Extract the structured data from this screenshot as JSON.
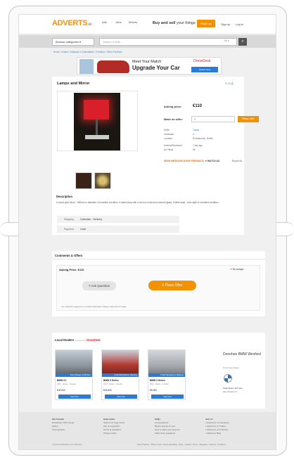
{
  "topbar": {
    "logo": "ADVERTS",
    "logo_suffix": ".ie",
    "tabs": [
      "Ads",
      "Jobs",
      "Motors"
    ],
    "tagline_prefix": "Buy and sell",
    "tagline_suffix": "your things",
    "place_ad": "Place ad",
    "signup": "Sign up",
    "login": "Log in"
  },
  "search": {
    "browse": "Browse categories",
    "placeholder": "Search in Ads ...",
    "scope": "All",
    "icon": "search-icon"
  },
  "breadcrumb": "Home › Ireland › Antiques & Collectables › Furniture › Other Furniture",
  "banner": {
    "line1": "Meet Your Match",
    "line2": "Upgrade Your Car",
    "brand": "DoneDeal",
    "cta": "Search Now"
  },
  "listing": {
    "title": "Lamps and Mirror",
    "asking_label": "Asking price:",
    "asking_value": "€110",
    "offer_label": "Make an offer:",
    "offer_placeholder": "€",
    "offer_button": "Place offer",
    "seller_rows": [
      {
        "k": "Seller",
        "v": "Troubt"
      },
      {
        "k": "Feedback",
        "v": "0"
      },
      {
        "k": "Location",
        "v": "Portmarnock, Dublin"
      },
      {
        "k": "Entered/Renewed",
        "v": "7 day ago"
      },
      {
        "k": "Ad Views",
        "v": "95"
      }
    ],
    "actions": [
      "SEND MESSAGE",
      "LEAVE FEEDBACK",
      "WATCH AD"
    ],
    "report": "Report Ad"
  },
  "description": {
    "heading": "Description",
    "text": "A round gold mirror - 800mm in diameter in excellent condition. A stand lamp with a red box head and coloured glass. A table lamp - retro style in excellent condition."
  },
  "options": [
    {
      "label": "Shipping",
      "value": "Collection · Delivery"
    },
    {
      "label": "Payment",
      "value": "Cash"
    }
  ],
  "comments": {
    "tab": "Comments & Offers",
    "asking": "Asking Price: €110",
    "no_swaps": "No swaps",
    "ask_question": "Ask Question",
    "place_offer": "Place Offer",
    "note": "You must be logged in to contact advertiser. Please click here to login."
  },
  "dealers": {
    "heading": "Local Dealers",
    "powered": "powered by",
    "brand": "DoneDeal",
    "cards": [
      {
        "name": "BMW X1",
        "sub": "2011 · Diesel · 3 dealer",
        "price": "€32,000",
        "tag": "Extra Mileage Certification",
        "view": "View Car"
      },
      {
        "name": "BMW 3 Series",
        "sub": "2013 · Diesel · 2 dealer",
        "price": "€16,500",
        "tag": "5 Star Manufacturer Warranty",
        "view": "View Car"
      },
      {
        "name": "BMW 3 Series",
        "sub": "2012 · Diesel · 2 dealer",
        "price": "€6,900",
        "tag": "5 Star Manufacturer Warranty",
        "view": "View Car"
      }
    ],
    "dealer_name": "Donohoe BMW Wexford",
    "dealer_sub": "Franchise Dealer",
    "dealer_total": "Total Stock: 112 cars",
    "dealer_link": "See Showroom"
  },
  "footer": {
    "cols": [
      {
        "head": "Our Friends",
        "items": [
          "DoneDeal | DSV Group",
          "Daft.ie",
          "Cherrypicked"
        ]
      },
      {
        "head": "Help centre",
        "items": [
          "Search our help centre",
          "Ask us a question",
          "Terms & conditions",
          "Privacy policy"
        ]
      },
      {
        "head": "FAQs",
        "items": [
          "Lost password",
          "Report and ad or user",
          "How to place your account",
          "Seller have explained"
        ]
      },
      {
        "head": "Join us",
        "items": [
          "Adverts.ie on Facebook",
          "Adverts.ie on Twitter",
          "Adverts.ie on Pinterest",
          "Adverts.ie Blog"
        ]
      }
    ],
    "copyright": "© Adverts Marketplace Ltd. 2005-2014",
    "links": "Help & Support · Shows of sale · Abuse advertising · Policy · Cookies · Terms · Categories · About us · Contact us"
  }
}
